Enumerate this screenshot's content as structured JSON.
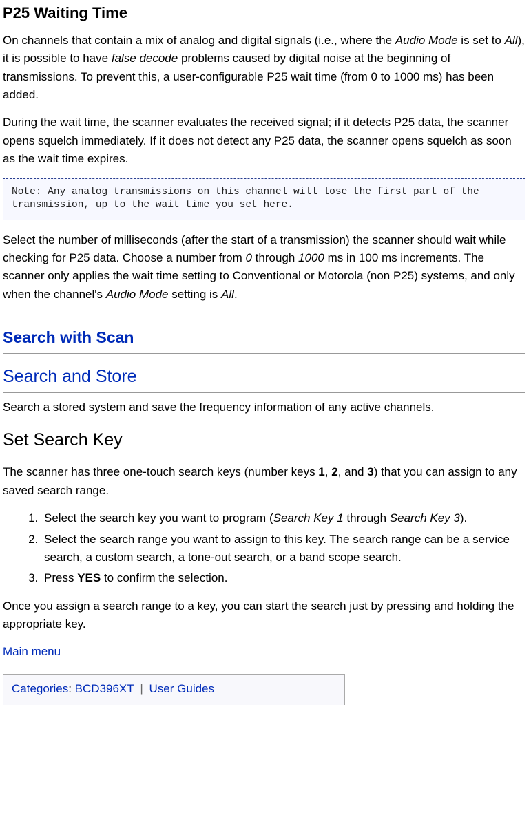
{
  "p25": {
    "heading": "P25 Waiting Time",
    "para1_pre": "On channels that contain a mix of analog and digital signals (i.e., where the ",
    "para1_i1": "Audio Mode",
    "para1_mid1": " is set to ",
    "para1_i2": "All",
    "para1_mid2": "), it is possible to have ",
    "para1_i3": "false decode",
    "para1_post": " problems caused by digital noise at the beginning of transmissions. To prevent this, a user-configurable P25 wait time (from 0 to 1000 ms) has been added.",
    "para2": "During the wait time, the scanner evaluates the received signal; if it detects P25 data, the scanner opens squelch immediately. If it does not detect any P25 data, the scanner opens squelch as soon as the wait time expires.",
    "note": "Note: Any analog transmissions on this channel will lose the first part of the transmission, up to the wait time you set here.",
    "para3_pre": "Select the number of milliseconds (after the start of a transmission) the scanner should wait while checking for P25 data. Choose a number from ",
    "para3_i1": "0",
    "para3_mid1": " through ",
    "para3_i2": "1000",
    "para3_mid2": " ms in 100 ms increments. The scanner only applies the wait time setting to Conventional or Motorola (non P25) systems, and only when the channel's ",
    "para3_i3": "Audio Mode",
    "para3_mid3": " setting is ",
    "para3_i4": "All",
    "para3_post": "."
  },
  "search_scan": {
    "heading": "Search with Scan",
    "store_heading": "Search and Store",
    "store_para": "Search a stored system and save the frequency information of any active channels.",
    "key_heading": "Set Search Key",
    "key_intro_pre": "The scanner has three one-touch search keys (number keys ",
    "key_intro_b1": "1",
    "key_intro_mid1": ", ",
    "key_intro_b2": "2",
    "key_intro_mid2": ", and ",
    "key_intro_b3": "3",
    "key_intro_post": ") that you can assign to any saved search range.",
    "steps": {
      "s1_pre": "Select the search key you want to program (",
      "s1_i1": "Search Key 1",
      "s1_mid": " through ",
      "s1_i2": "Search Key 3",
      "s1_post": ").",
      "s2": "Select the search range you want to assign to this key. The search range can be a service search, a custom search, a tone-out search, or a band scope search.",
      "s3_pre": "Press ",
      "s3_b": "YES",
      "s3_post": " to confirm the selection."
    },
    "outro": "Once you assign a search range to a key, you can start the search just by pressing and holding the appropriate key.",
    "main_menu": "Main menu"
  },
  "cats": {
    "label": "Categories",
    "cat1": "BCD396XT",
    "cat2": "User Guides"
  }
}
